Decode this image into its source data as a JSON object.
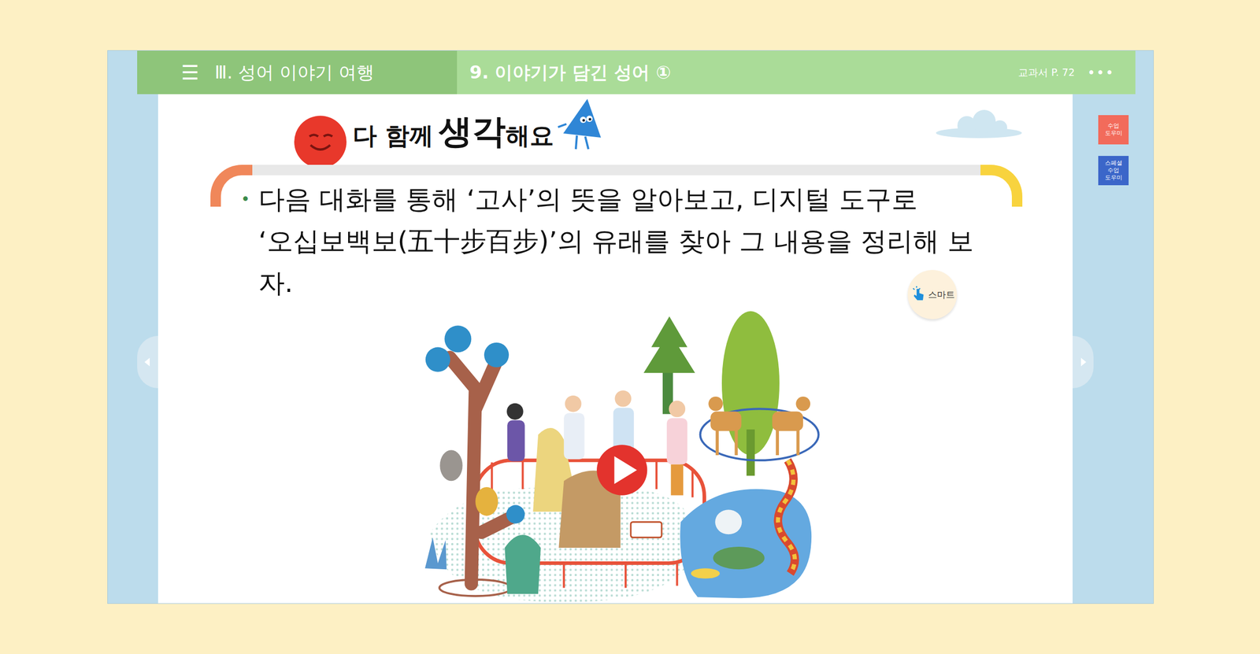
{
  "header": {
    "menu_icon": "☰",
    "unit": "Ⅲ. 성어 이야기 여행",
    "lesson": "9. 이야기가 담긴 성어 ①",
    "page": "교과서 P. 72",
    "more": "•••"
  },
  "side_buttons": [
    {
      "label": "수업 도우미",
      "color": "#f26b5b"
    },
    {
      "label": "스페셜 수업 도우미",
      "color": "#3b66c9"
    }
  ],
  "section": {
    "prefix": "다 함께",
    "emphasis": "생각",
    "suffix": "해요"
  },
  "instruction": {
    "bullet": "•",
    "lines": [
      "다음 대화를 통해 ‘고사’의 뜻을 알아보고, 디지털 도구로",
      "‘오십보백보(五十步百步)’의 유래를 찾아 그 내용을 정리해 보자."
    ]
  },
  "smart_badge": "스마트",
  "pages": [
    {
      "selected": true
    },
    {
      "selected": false
    }
  ]
}
